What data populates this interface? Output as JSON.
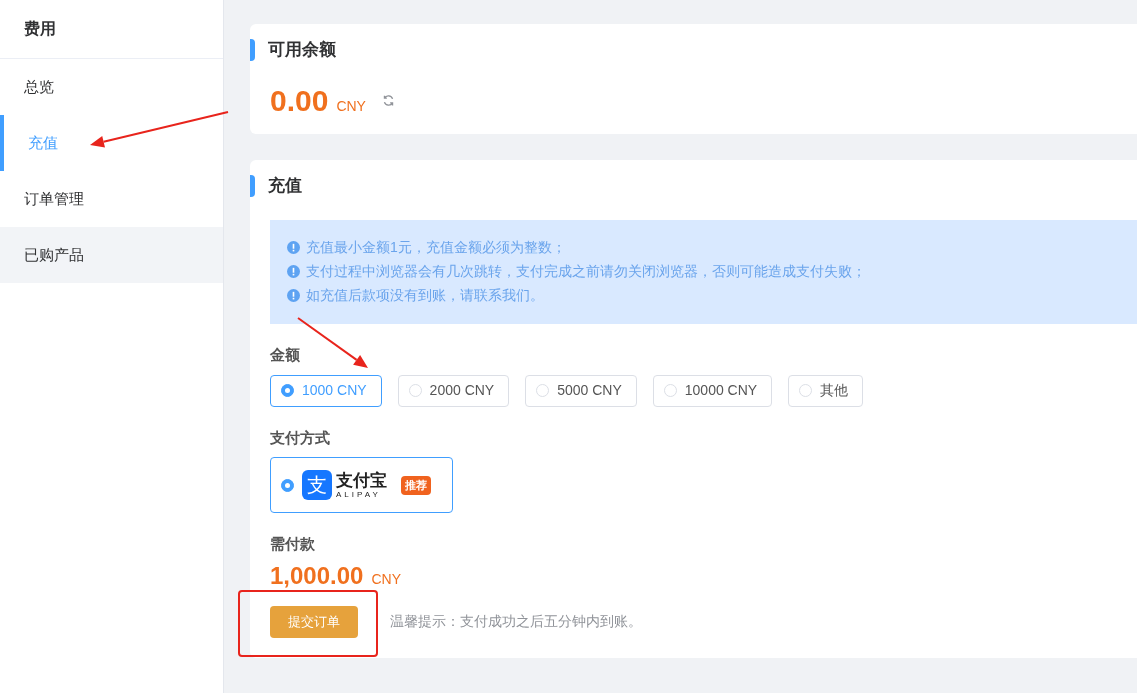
{
  "sidebar": {
    "title": "费用",
    "items": [
      {
        "label": "总览",
        "selected": false,
        "hovered": false
      },
      {
        "label": "充值",
        "selected": true,
        "hovered": false
      },
      {
        "label": "订单管理",
        "selected": false,
        "hovered": false
      },
      {
        "label": "已购产品",
        "selected": false,
        "hovered": true
      }
    ]
  },
  "balance": {
    "title": "可用余额",
    "amount": "0.00",
    "currency": "CNY"
  },
  "recharge": {
    "title": "充值",
    "notices": [
      "充值最小金额1元，充值金额必须为整数；",
      "支付过程中浏览器会有几次跳转，支付完成之前请勿关闭浏览器，否则可能造成支付失败；",
      "如充值后款项没有到账，请联系我们。"
    ],
    "amount_label": "金额",
    "amounts": [
      {
        "label": "1000 CNY",
        "selected": true
      },
      {
        "label": "2000 CNY",
        "selected": false
      },
      {
        "label": "5000 CNY",
        "selected": false
      },
      {
        "label": "10000 CNY",
        "selected": false
      },
      {
        "label": "其他",
        "selected": false
      }
    ],
    "payment_label": "支付方式",
    "payment_methods": [
      {
        "logo_mark": "支",
        "name": "支付宝",
        "subtitle": "ALIPAY",
        "badge": "推荐",
        "selected": true
      }
    ],
    "due_label": "需付款",
    "due_amount": "1,000.00",
    "due_currency": "CNY",
    "submit": "提交订单",
    "tip": "温馨提示：支付成功之后五分钟内到账。"
  },
  "annotations": [
    {
      "kind": "arrow"
    },
    {
      "kind": "arrow"
    },
    {
      "kind": "box"
    }
  ]
}
